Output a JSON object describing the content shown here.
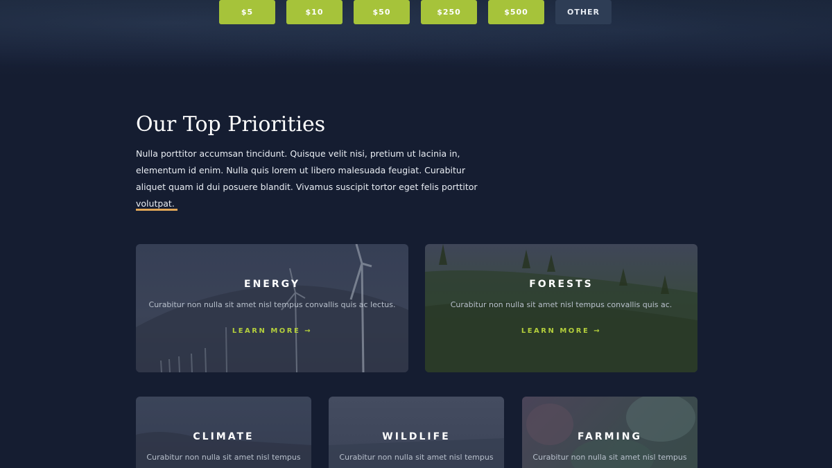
{
  "donation": {
    "amounts": [
      "$5",
      "$10",
      "$50",
      "$250",
      "$500"
    ],
    "other_label": "OTHER"
  },
  "intro": {
    "heading": "Our Top Priorities",
    "body": "Nulla porttitor accumsan tincidunt. Quisque velit nisi, pretium ut lacinia in, elementum id enim. Nulla quis lorem ut libero malesuada feugiat. Curabitur aliquet quam id dui posuere blandit. Vivamus suscipit tortor eget felis porttitor volutpat."
  },
  "cards": [
    {
      "title": "ENERGY",
      "desc": "Curabitur non nulla sit amet nisl tempus convallis quis ac lectus.",
      "more": "LEARN MORE →"
    },
    {
      "title": "FORESTS",
      "desc": "Curabitur non nulla sit amet nisl tempus convallis quis ac.",
      "more": "LEARN MORE →"
    },
    {
      "title": "CLIMATE",
      "desc": "Curabitur non nulla sit amet nisl tempus"
    },
    {
      "title": "WILDLIFE",
      "desc": "Curabitur non nulla sit amet nisl tempus"
    },
    {
      "title": "FARMING",
      "desc": "Curabitur non nulla sit amet nisl tempus"
    }
  ],
  "colors": {
    "background": "#151d31",
    "accent_green": "#a6c33a",
    "other_button": "#2e3d55",
    "divider_gold": "#e0a657",
    "link_green": "#b4cf3c"
  }
}
